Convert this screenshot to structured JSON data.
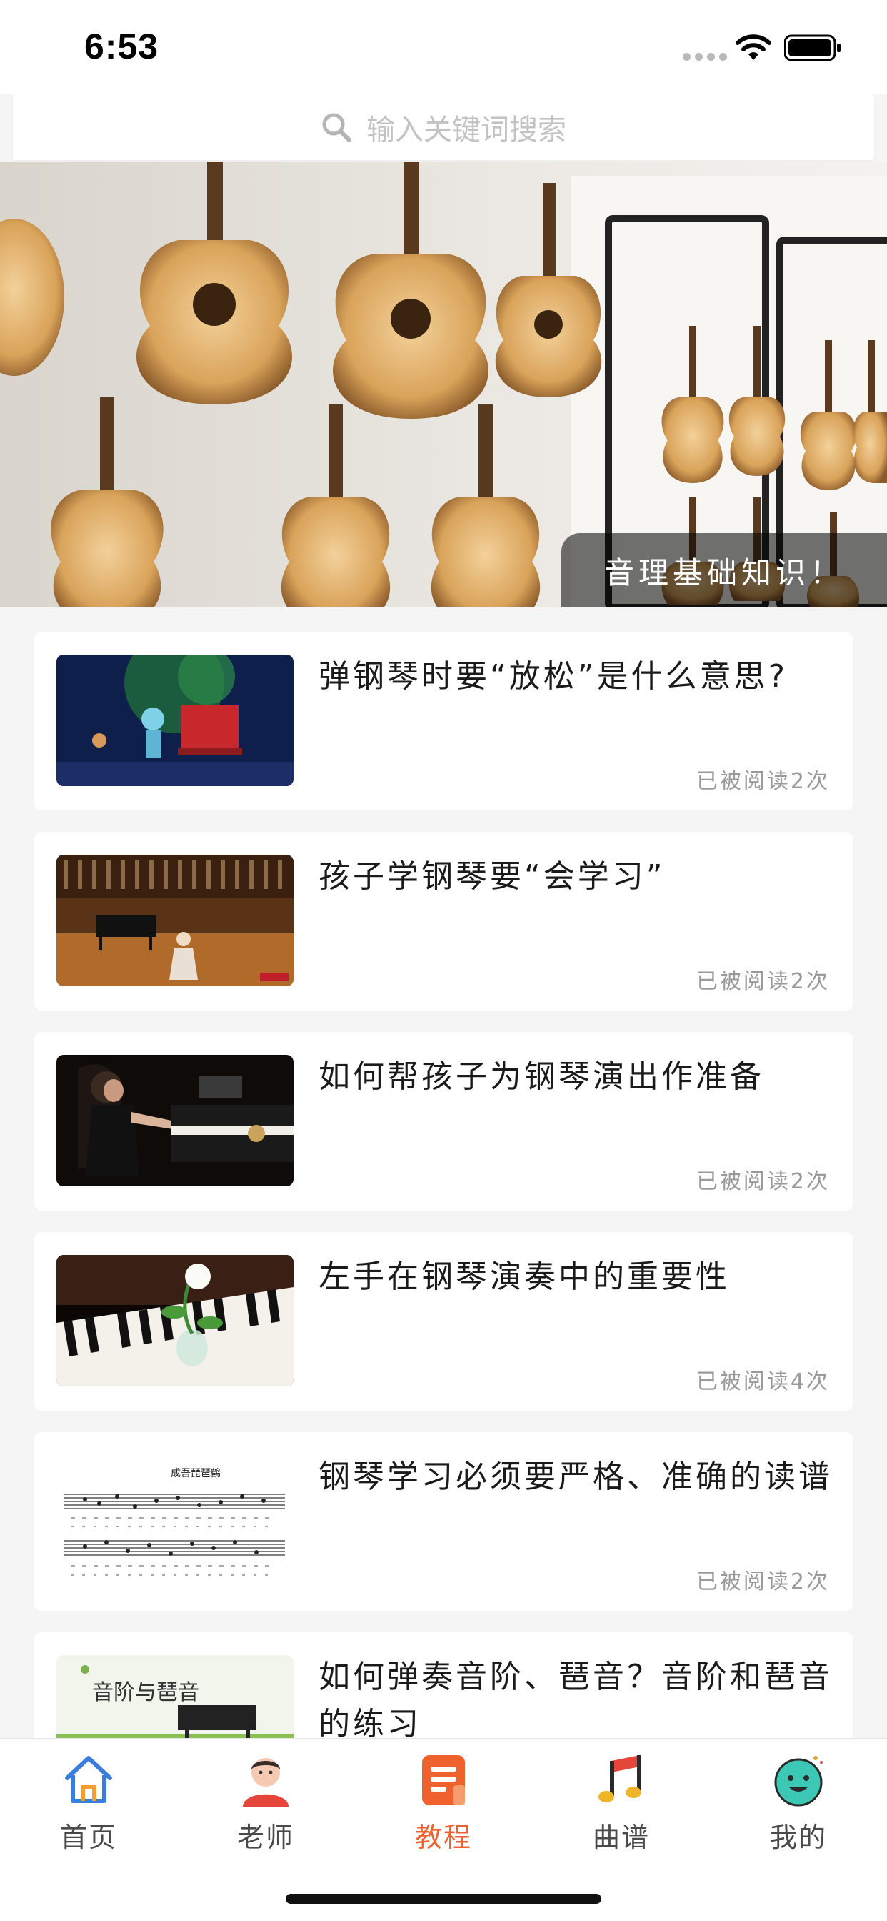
{
  "status_bar": {
    "time": "6:53"
  },
  "search": {
    "placeholder": "输入关键词搜索"
  },
  "banner": {
    "caption": "音理基础知识！"
  },
  "articles": [
    {
      "title": "弹钢琴时要“放松”是什么意思?",
      "reads": "已被阅读2次"
    },
    {
      "title": "孩子学钢琴要“会学习”",
      "reads": "已被阅读2次"
    },
    {
      "title": "如何帮孩子为钢琴演出作准备",
      "reads": "已被阅读2次"
    },
    {
      "title": "左手在钢琴演奏中的重要性",
      "reads": "已被阅读4次"
    },
    {
      "title": "钢琴学习必须要严格、准确的读谱",
      "reads": "已被阅读2次"
    },
    {
      "title": "如何弹奏音阶、琶音？音阶和琶音的练习",
      "reads": ""
    }
  ],
  "thumbs": {
    "book_title": "音阶与琶音",
    "sheet_title": "成吾琵琶鹤"
  },
  "tabs": [
    {
      "label": "首页",
      "icon": "home-icon"
    },
    {
      "label": "老师",
      "icon": "teacher-icon"
    },
    {
      "label": "教程",
      "icon": "tutorial-icon",
      "active": true
    },
    {
      "label": "曲谱",
      "icon": "music-note-icon"
    },
    {
      "label": "我的",
      "icon": "profile-face-icon"
    }
  ],
  "colors": {
    "accent": "#f0622d",
    "home_blue": "#3b7ddd",
    "background": "#f5f5f5"
  }
}
